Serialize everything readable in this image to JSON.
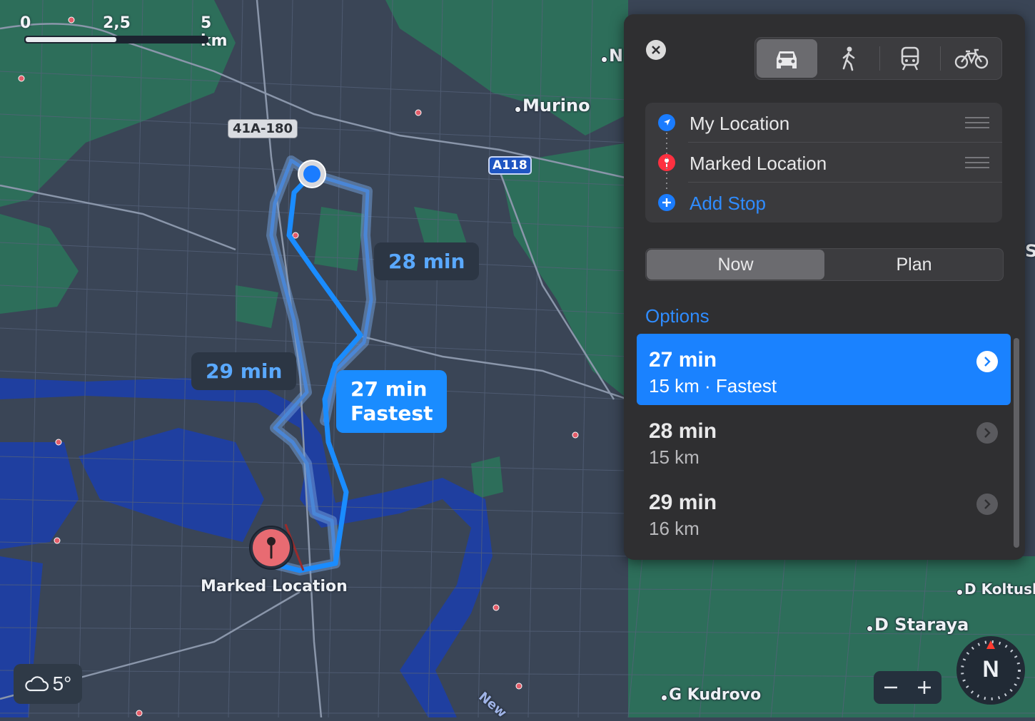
{
  "map": {
    "scale": {
      "zero": "0",
      "mid": "2,5",
      "end": "5 km"
    },
    "places": {
      "murino": "Murino",
      "n_partial": "N",
      "koltush": "D Koltush",
      "staraya": "D Staraya",
      "kudrovo": "G Kudrovo",
      "edge_partial": "S",
      "river": "New"
    },
    "road_shields": {
      "a": "41A-180",
      "b": "A118"
    },
    "destination_label": "Marked Location",
    "route_callouts": {
      "route_28": "28 min",
      "route_29": "29 min",
      "route_27_time": "27 min",
      "route_27_tag": "Fastest"
    },
    "weather": {
      "icon": "cloud-icon",
      "temp": "5°"
    },
    "compass": {
      "heading": "N"
    },
    "colors": {
      "water": "#1f3fa0",
      "park": "#2d6e5a",
      "land": "#3a4556",
      "route_active": "#1a8cff",
      "route_alt": "#4e8fd8"
    }
  },
  "panel": {
    "transport_modes": [
      {
        "name": "drive",
        "icon": "car-icon",
        "selected": true
      },
      {
        "name": "walk",
        "icon": "walk-icon",
        "selected": false
      },
      {
        "name": "transit",
        "icon": "train-icon",
        "selected": false
      },
      {
        "name": "cycle",
        "icon": "bike-icon",
        "selected": false
      }
    ],
    "stops": {
      "origin": "My Location",
      "destination": "Marked Location",
      "add": "Add Stop"
    },
    "time_tabs": {
      "now": "Now",
      "plan": "Plan",
      "selected": "Now"
    },
    "options_header": "Options",
    "routes": [
      {
        "time": "27 min",
        "detail": "15 km · Fastest",
        "selected": true
      },
      {
        "time": "28 min",
        "detail": "15 km",
        "selected": false
      },
      {
        "time": "29 min",
        "detail": "16 km",
        "selected": false
      }
    ]
  }
}
